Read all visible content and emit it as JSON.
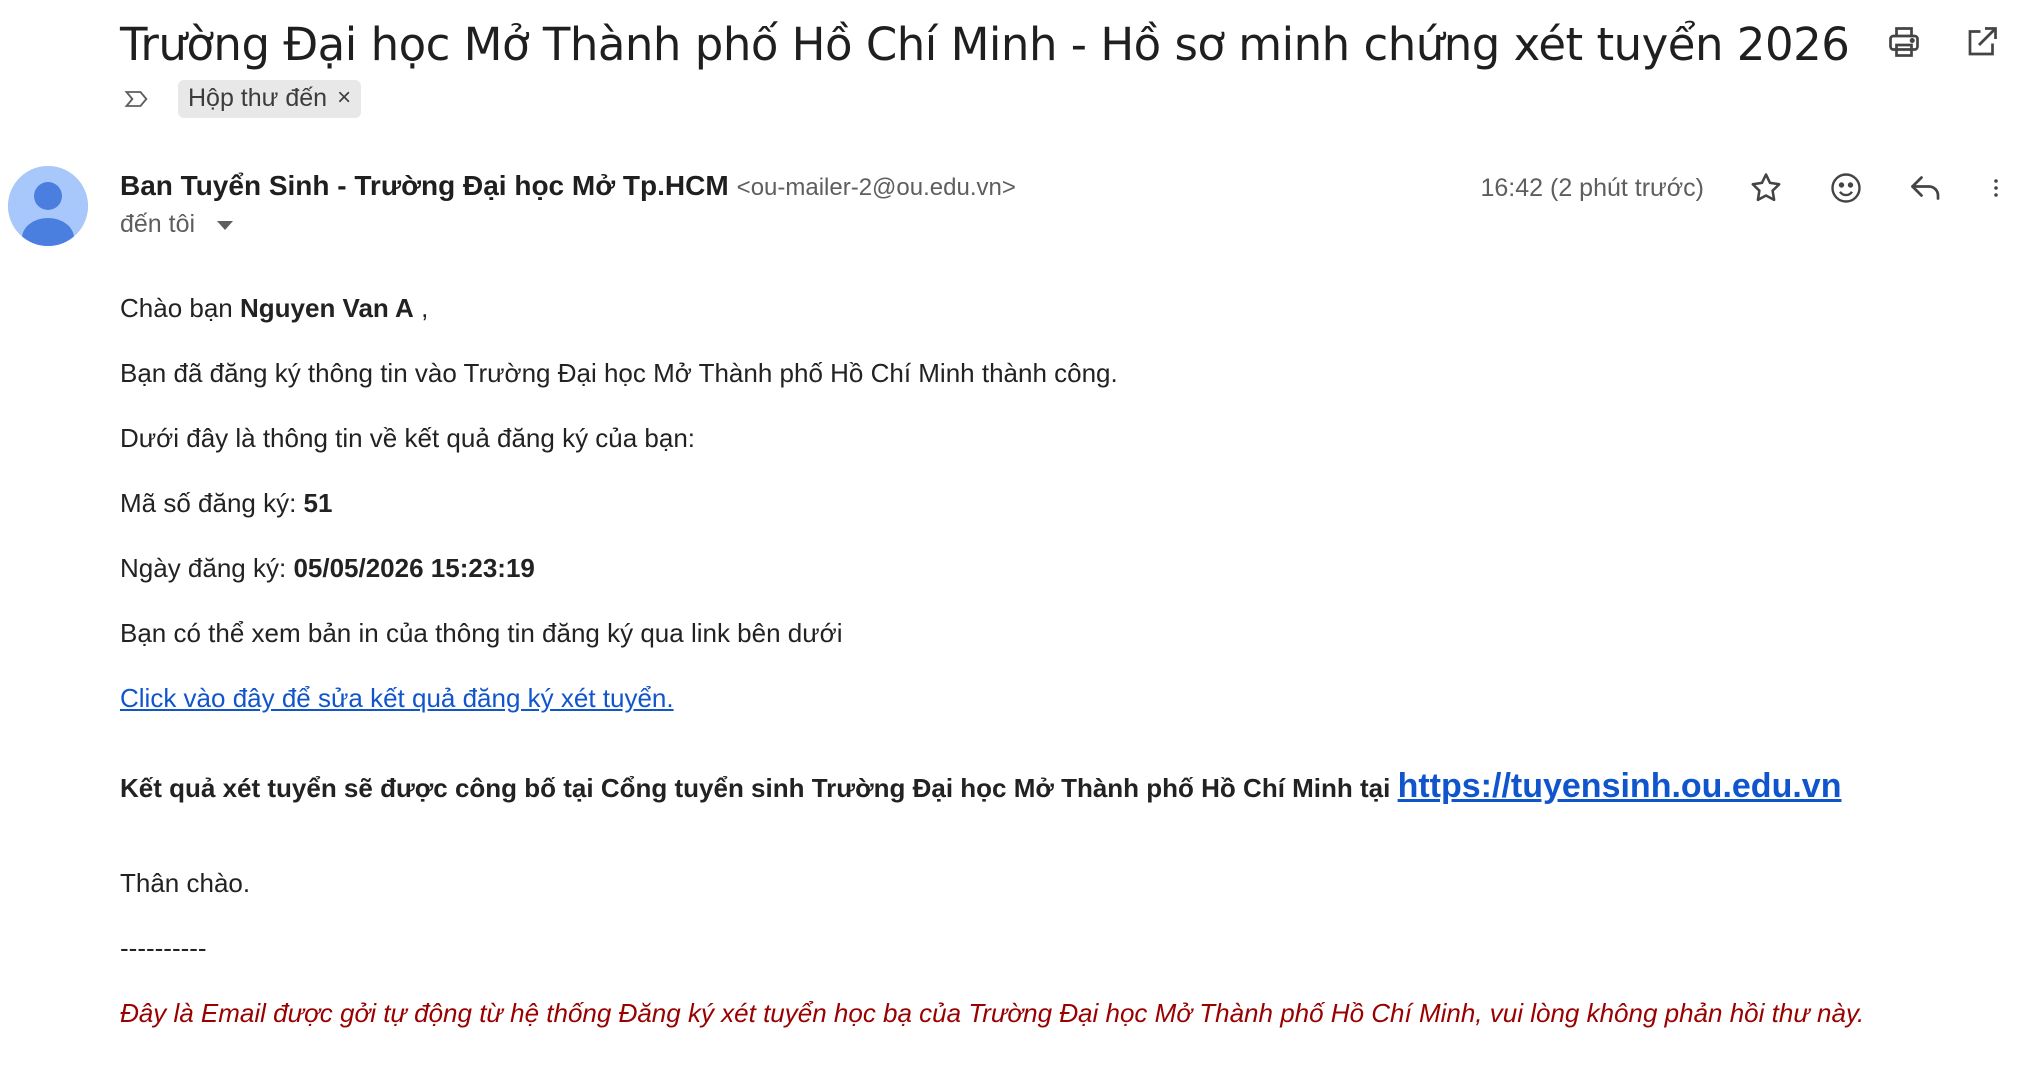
{
  "header": {
    "subject": "Trường Đại học Mở Thành phố Hồ Chí Minh - Hồ sơ minh chứng xét tuyển 2026",
    "label_chip": "Hộp thư đến",
    "label_remove": "×"
  },
  "sender": {
    "name": "Ban Tuyển Sinh - Trường Đại học Mở Tp.HCM",
    "email": "<ou-mailer-2@ou.edu.vn>",
    "to": "đến tôi",
    "timestamp": "16:42 (2 phút trước)"
  },
  "body": {
    "greeting_prefix": "Chào bạn ",
    "greeting_name": "Nguyen Van A",
    "greeting_suffix": " ,",
    "line_success": "Bạn đã đăng ký thông tin vào Trường Đại học Mở Thành phố Hồ Chí Minh thành công.",
    "line_info_intro": "Dưới đây là thông tin về kết quả đăng ký của bạn:",
    "reg_no_label": "Mã số đăng ký: ",
    "reg_no_value": "51",
    "reg_date_label": "Ngày đăng ký: ",
    "reg_date_value": "05/05/2026 15:23:19",
    "line_print": "Bạn có thể xem bản in của thông tin đăng ký qua link bên dưới",
    "edit_link": "Click vào đây để sửa kết quả đăng ký xét tuyển.",
    "announce_text": "Kết quả xét tuyển sẽ được công bố tại Cổng tuyển sinh Trường Đại học Mở Thành phố Hồ Chí Minh tại ",
    "announce_link": "https://tuyensinh.ou.edu.vn",
    "closing": "Thân chào.",
    "separator": "----------",
    "auto_note": "Đây là Email được gởi tự động từ hệ thống Đăng ký xét tuyển học bạ của Trường Đại học Mở Thành phố Hồ Chí Minh, vui lòng không phản hồi thư này."
  },
  "icons": {
    "print": "print-icon",
    "open_new": "open-in-new-window-icon",
    "importance": "importance-marker-icon",
    "star": "star-icon",
    "emoji": "emoji-reaction-icon",
    "reply": "reply-icon",
    "more": "more-vert-icon",
    "avatar": "default-avatar-icon"
  },
  "colors": {
    "link": "#1155cc",
    "note_red": "#990000",
    "avatar_bg": "#a8c7fa",
    "avatar_fg": "#4a7fe0"
  }
}
